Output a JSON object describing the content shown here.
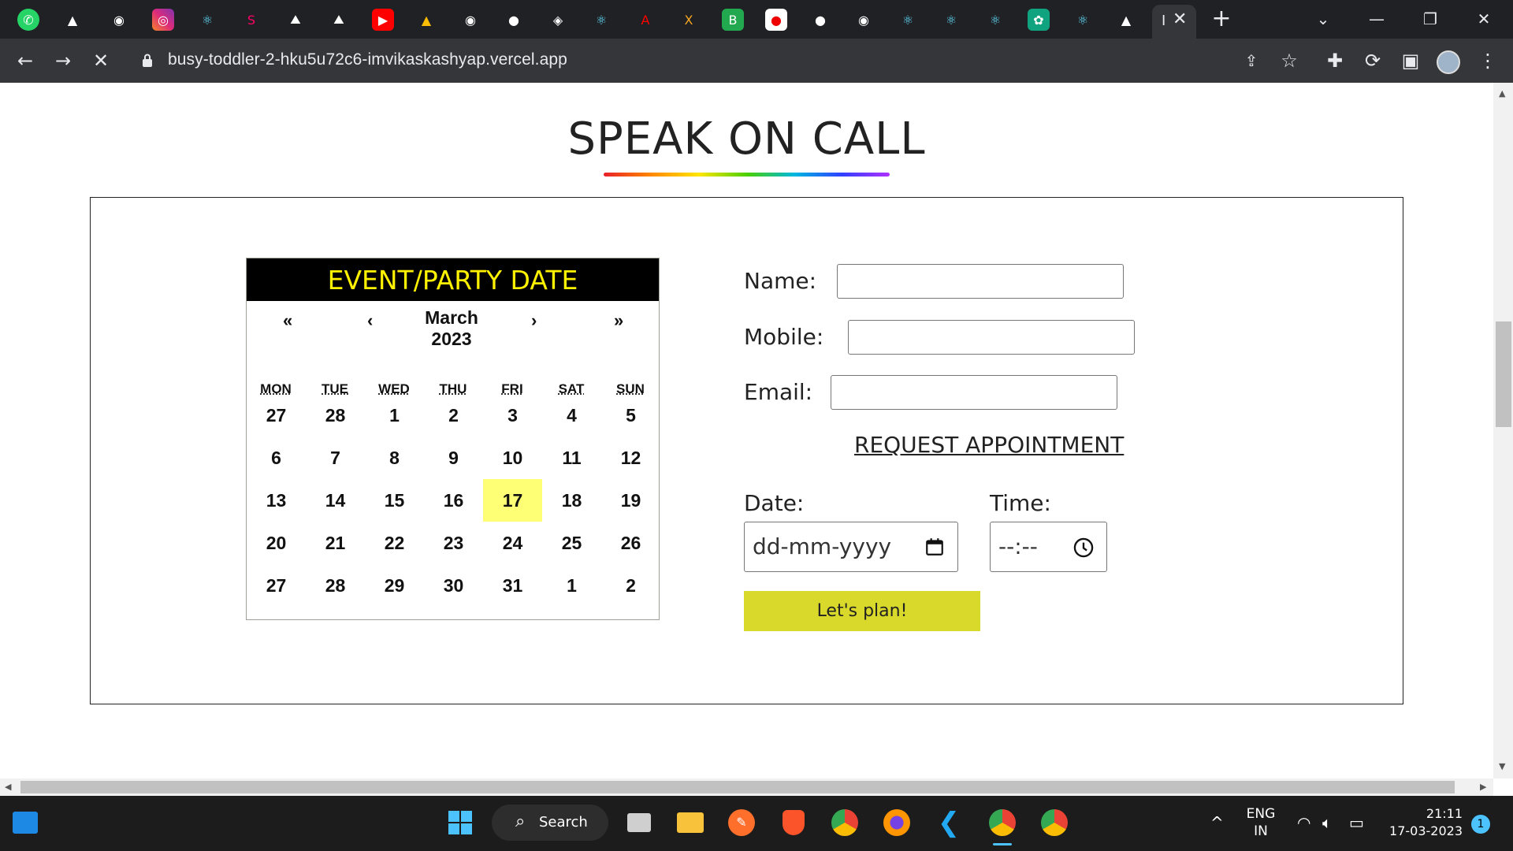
{
  "browser": {
    "url": "busy-toddler-2-hku5u72c6-imvikaskashyap.vercel.app",
    "active_tab_glyph": "I"
  },
  "page": {
    "title": "SPEAK ON CALL"
  },
  "calendar": {
    "header": "EVENT/PARTY DATE",
    "month": "March",
    "year": "2023",
    "nav_prev_year": "«",
    "nav_prev_month": "‹",
    "nav_next_month": "›",
    "nav_next_year": "»",
    "weekdays": [
      "MON",
      "TUE",
      "WED",
      "THU",
      "FRI",
      "SAT",
      "SUN"
    ],
    "weeks": [
      [
        "27",
        "28",
        "1",
        "2",
        "3",
        "4",
        "5"
      ],
      [
        "6",
        "7",
        "8",
        "9",
        "10",
        "11",
        "12"
      ],
      [
        "13",
        "14",
        "15",
        "16",
        "17",
        "18",
        "19"
      ],
      [
        "20",
        "21",
        "22",
        "23",
        "24",
        "25",
        "26"
      ],
      [
        "27",
        "28",
        "29",
        "30",
        "31",
        "1",
        "2"
      ]
    ],
    "today": "17",
    "highlight_color": "#ffff76"
  },
  "form": {
    "name_label": "Name:",
    "mobile_label": "Mobile:",
    "email_label": "Email:",
    "name_value": "",
    "mobile_value": "",
    "email_value": "",
    "request_link": "REQUEST APPOINTMENT",
    "date_label": "Date:",
    "date_placeholder": "dd-mm-yyyy",
    "time_label": "Time:",
    "time_placeholder": "--:--",
    "submit_label": "Let's plan!",
    "submit_color": "#d9d92b"
  },
  "taskbar": {
    "search_label": "Search",
    "language_line1": "ENG",
    "language_line2": "IN",
    "time": "21:11",
    "date": "17-03-2023",
    "notification_count": "1"
  }
}
